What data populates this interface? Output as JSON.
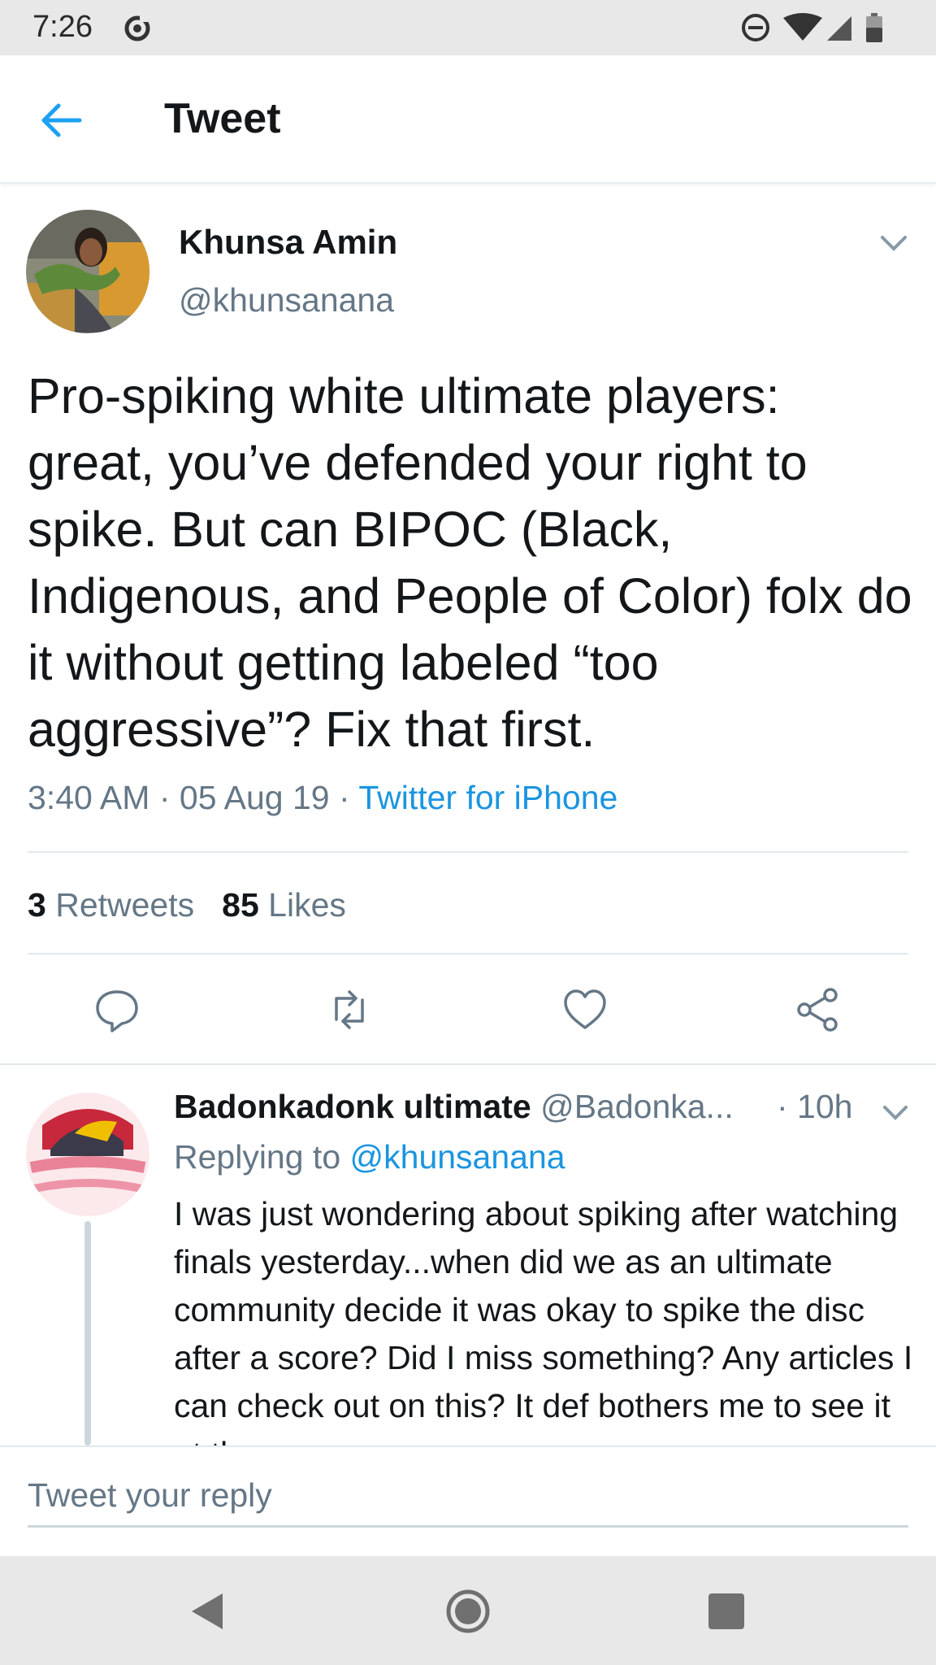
{
  "status_bar": {
    "time": "7:26",
    "icons": [
      "sync-icon",
      "do-not-disturb-icon",
      "wifi-icon",
      "signal-icon",
      "battery-icon"
    ]
  },
  "header": {
    "title": "Tweet",
    "back_icon": "back-arrow-icon"
  },
  "tweet": {
    "author_name": "Khunsa Amin",
    "author_handle": "@khunsanana",
    "text": "Pro-spiking white ultimate players: great, you’ve defended your right to spike. But can BIPOC (Black, Indigenous, and People of Color) folx do it without getting labeled “too aggressive”? Fix that first.",
    "time": "3:40 AM",
    "date": "05 Aug 19",
    "separator": "·",
    "source": "Twitter for iPhone",
    "retweets_count": "3",
    "retweets_label": "Retweets",
    "likes_count": "85",
    "likes_label": "Likes"
  },
  "actions": [
    "reply-icon",
    "retweet-icon",
    "like-icon",
    "share-icon"
  ],
  "reply": {
    "author_name": "Badonkadonk ultimate",
    "author_handle": "@Badonka...",
    "time": "· 10h",
    "replying_to_label": "Replying to",
    "replying_to_handle": "@khunsanana",
    "text": "I was just wondering about spiking after watching finals yesterday...when did we as an ultimate community decide it was okay to spike the disc after a score? Did I miss something? Any articles I can check out on this? It def bothers me to see it at the"
  },
  "compose": {
    "placeholder": "Tweet your reply"
  },
  "colors": {
    "accent": "#1da1f2",
    "link": "#1b95e0",
    "secondary_text": "#657786",
    "primary_text": "#14171a"
  }
}
